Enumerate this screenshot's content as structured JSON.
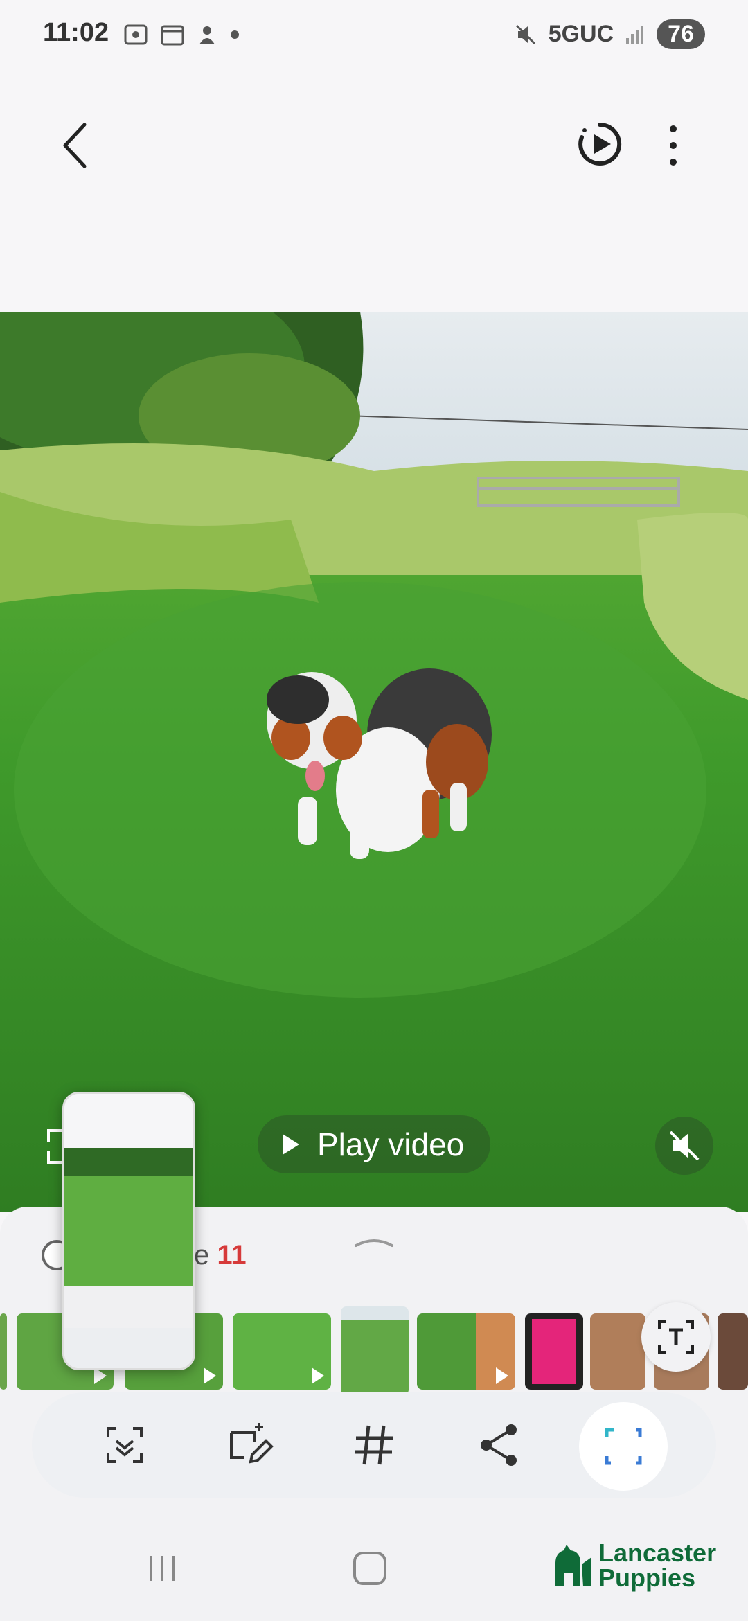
{
  "status_bar": {
    "time": "11:02",
    "network": "5GUC",
    "battery": "76"
  },
  "toolbar": {
    "back_icon": "back-icon",
    "motion_icon": "motion-photo-play-icon",
    "more_icon": "more-vert-icon"
  },
  "viewer": {
    "play_label": "Play video",
    "mute_icon": "volume-mute-icon"
  },
  "sheet": {
    "album_suffix": "e",
    "album_count": "11"
  },
  "actions": [
    {
      "name": "select-scroll-icon"
    },
    {
      "name": "edit-icon"
    },
    {
      "name": "hashtag-icon"
    },
    {
      "name": "share-icon"
    },
    {
      "name": "focus-frame-icon"
    }
  ],
  "logo": {
    "line1": "Lancaster",
    "line2": "Puppies"
  },
  "colors": {
    "accent": "#2a7bd6",
    "count_red": "#d63a3a",
    "logo_green": "#0f6b38"
  }
}
